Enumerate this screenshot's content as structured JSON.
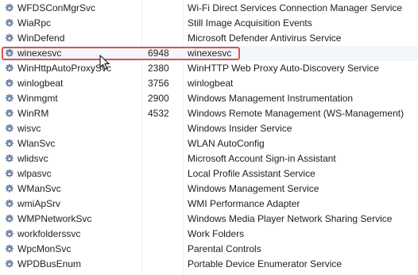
{
  "services": [
    {
      "name": "WFDSConMgrSvc",
      "pid": "",
      "description": "Wi-Fi Direct Services Connection Manager Service"
    },
    {
      "name": "WiaRpc",
      "pid": "",
      "description": "Still Image Acquisition Events"
    },
    {
      "name": "WinDefend",
      "pid": "",
      "description": "Microsoft Defender Antivirus Service"
    },
    {
      "name": "winexesvc",
      "pid": "6948",
      "description": "winexesvc",
      "selected": true
    },
    {
      "name": "WinHttpAutoProxySvc",
      "pid": "2380",
      "description": "WinHTTP Web Proxy Auto-Discovery Service"
    },
    {
      "name": "winlogbeat",
      "pid": "3756",
      "description": "winlogbeat"
    },
    {
      "name": "Winmgmt",
      "pid": "2900",
      "description": "Windows Management Instrumentation"
    },
    {
      "name": "WinRM",
      "pid": "4532",
      "description": "Windows Remote Management (WS-Management)"
    },
    {
      "name": "wisvc",
      "pid": "",
      "description": "Windows Insider Service"
    },
    {
      "name": "WlanSvc",
      "pid": "",
      "description": "WLAN AutoConfig"
    },
    {
      "name": "wlidsvc",
      "pid": "",
      "description": "Microsoft Account Sign-in Assistant"
    },
    {
      "name": "wlpasvc",
      "pid": "",
      "description": "Local Profile Assistant Service"
    },
    {
      "name": "WManSvc",
      "pid": "",
      "description": "Windows Management Service"
    },
    {
      "name": "wmiApSrv",
      "pid": "",
      "description": "WMI Performance Adapter"
    },
    {
      "name": "WMPNetworkSvc",
      "pid": "",
      "description": "Windows Media Player Network Sharing Service"
    },
    {
      "name": "workfolderssvc",
      "pid": "",
      "description": "Work Folders"
    },
    {
      "name": "WpcMonSvc",
      "pid": "",
      "description": "Parental Controls"
    },
    {
      "name": "WPDBusEnum",
      "pid": "",
      "description": "Portable Device Enumerator Service"
    }
  ],
  "icon": "service-gear-icon",
  "colors": {
    "highlight": "#e0534a",
    "gear": "#6d86a8"
  }
}
